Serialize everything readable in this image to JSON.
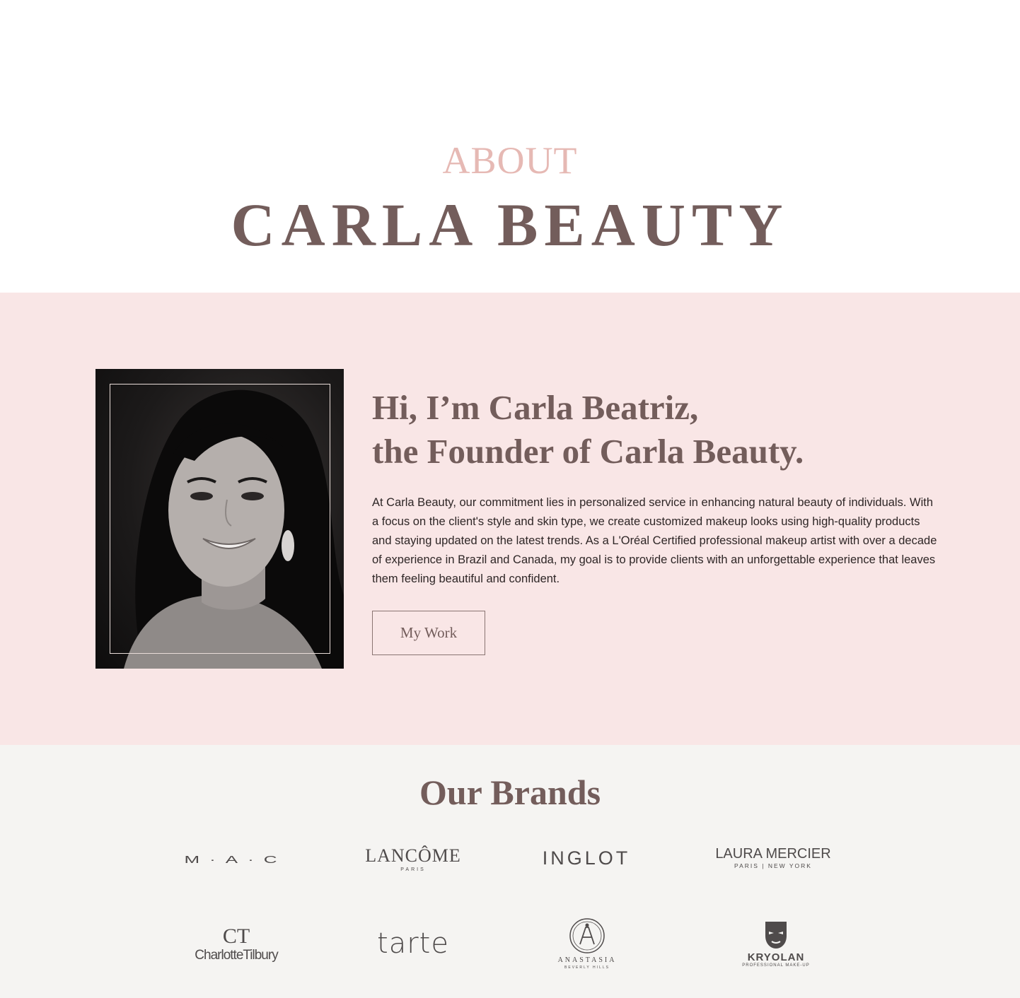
{
  "hero": {
    "eyebrow": "ABOUT",
    "title": "CARLA BEAUTY"
  },
  "about": {
    "portrait_alt": "Portrait of Carla Beatriz",
    "heading_line1": "Hi, I’m Carla Beatriz,",
    "heading_line2": "the Founder of Carla Beauty.",
    "body": "At Carla Beauty, our commitment lies in personalized service in enhancing natural beauty of individuals. With a focus on the client's style and skin type, we create customized makeup looks using high-quality products and staying updated on the latest trends. As a L'Oréal Certified professional makeup artist with over a decade of experience in Brazil and Canada, my goal is to provide clients with an unforgettable experience that leaves them feeling beautiful and confident.",
    "button_label": "My Work"
  },
  "brands": {
    "title": "Our Brands",
    "items": [
      {
        "name": "M·A·C",
        "sub": ""
      },
      {
        "name": "LANCÔME",
        "sub": "PARIS"
      },
      {
        "name": "INGLOT",
        "sub": ""
      },
      {
        "name": "LAURA MERCIER",
        "sub": "PARIS | NEW YORK"
      },
      {
        "name": "CharlotteTilbury",
        "sub": "",
        "monogram": "CT"
      },
      {
        "name": "tarte",
        "sub": ""
      },
      {
        "name": "ANASTASIA",
        "sub": "BEVERLY HILLS"
      },
      {
        "name": "KRYOLAN",
        "sub": "PROFESSIONAL MAKE-UP"
      }
    ]
  },
  "colors": {
    "accent_pink": "#e6b9b4",
    "brand_brown": "#735d5b",
    "about_bg": "#f9e6e6",
    "brands_bg": "#f5f4f2"
  }
}
